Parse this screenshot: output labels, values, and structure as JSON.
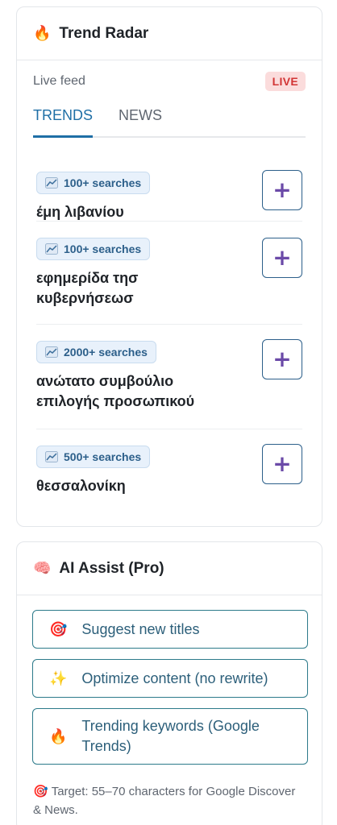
{
  "trend_radar": {
    "icon": "fire-icon",
    "title": "Trend Radar",
    "feed_label": "Live feed",
    "live_badge": "LIVE",
    "tabs": [
      {
        "label": "TRENDS",
        "active": true
      },
      {
        "label": "NEWS",
        "active": false
      }
    ],
    "items": [
      {
        "searches": "100+ searches",
        "term": "έμη λιβανίου",
        "add_label": "+"
      },
      {
        "searches": "100+ searches",
        "term": "εφημερίδα τησ κυβερνήσεωσ",
        "add_label": "+"
      },
      {
        "searches": "2000+ searches",
        "term": "ανώτατο συμβούλιο επιλογής προσωπικού",
        "add_label": "+"
      },
      {
        "searches": "500+ searches",
        "term": "θεσσαλονίκη",
        "add_label": "+"
      }
    ]
  },
  "ai_assist": {
    "icon": "brain-icon",
    "title": "AI Assist (Pro)",
    "buttons": [
      {
        "icon": "target-icon",
        "label": "Suggest new titles"
      },
      {
        "icon": "sparkles-icon",
        "label": "Optimize content (no rewrite)"
      },
      {
        "icon": "fire-icon",
        "label": "Trending keywords (Google Trends)"
      }
    ],
    "note": "Target: 55–70 characters for Google Discover & News."
  },
  "colors": {
    "accent": "#1f6fa6",
    "live_badge_bg": "#fbdcdc",
    "live_badge_text": "#d23535",
    "plus": "#6b4aa8"
  }
}
